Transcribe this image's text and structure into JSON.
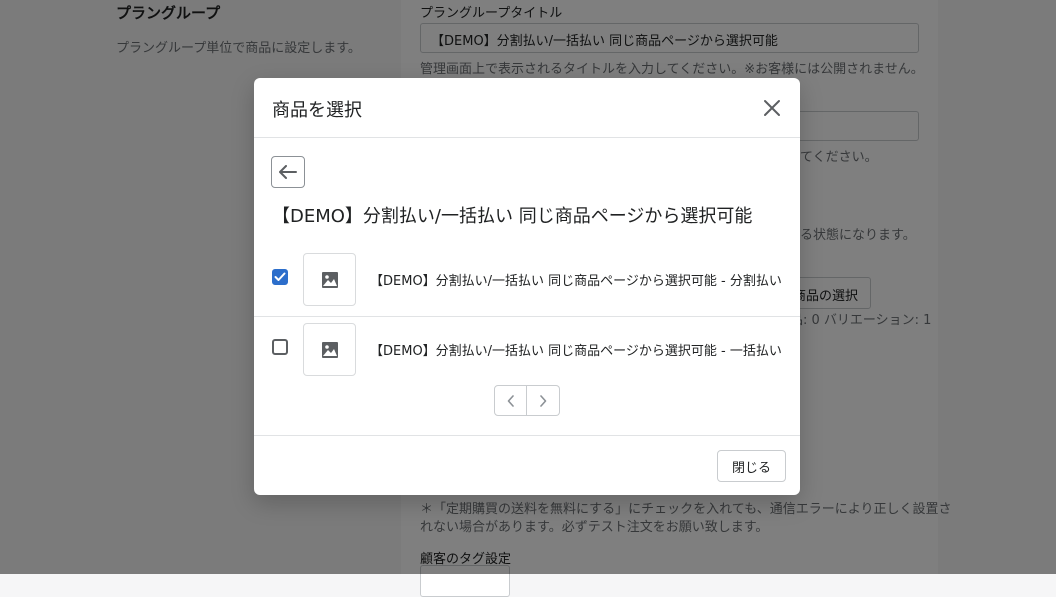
{
  "background": {
    "section_title": "プラングループ",
    "section_desc": "プラングループ単位で商品に設定します。",
    "group_title_label": "プラングループタイトル",
    "group_title_value": "【DEMO】分割払い/一括払い 同じ商品ページから選択可能",
    "group_title_help": "管理画面上で表示されるタイトルを入力してください。※お客様には公開されません。",
    "help_2": "てください。",
    "help_3": "る状態になります。",
    "select_product_button": "商品の選択",
    "variation_count": "品: 0 バリエーション: 1",
    "shipping_note_line1": "＊「定期購買の送料を無料にする」にチェックを入れても、通信エラーにより正しく設置さ",
    "shipping_note_line2": "れない場合があります。必ずテスト注文をお願い致します。",
    "customer_tag_label": "顧客のタグ設定"
  },
  "modal": {
    "title": "商品を選択",
    "product_title": "【DEMO】分割払い/一括払い 同じ商品ページから選択可能",
    "variants": [
      {
        "label": "【DEMO】分割払い/一括払い 同じ商品ページから選択可能 - 分割払い",
        "checked": true
      },
      {
        "label": "【DEMO】分割払い/一括払い 同じ商品ページから選択可能 - 一括払い",
        "checked": false
      }
    ],
    "close_button": "閉じる"
  },
  "colors": {
    "accent": "#2c6ecb",
    "overlay": "rgba(0,0,0,0.5)"
  },
  "icons": {
    "close": "close-icon",
    "back": "arrow-left-icon",
    "image": "image-placeholder-icon",
    "prev": "chevron-left-icon",
    "next": "chevron-right-icon",
    "check": "checkmark-icon"
  }
}
